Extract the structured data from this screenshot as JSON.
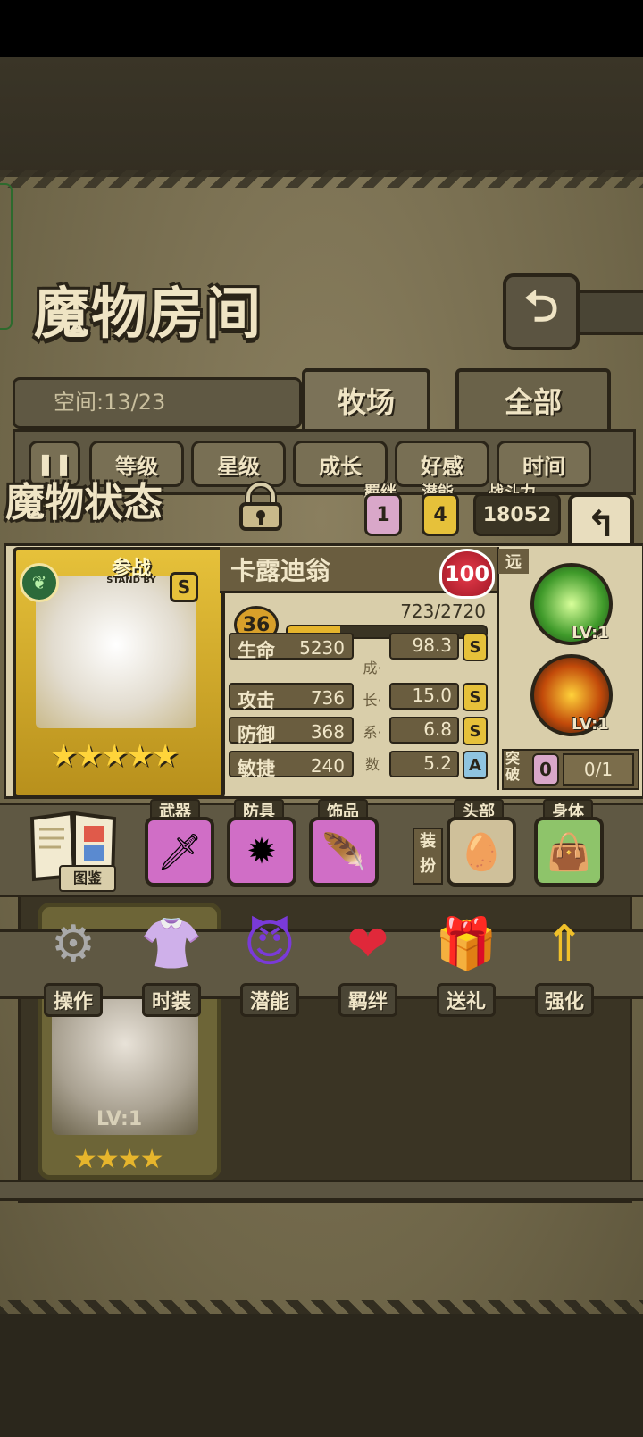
{
  "room": {
    "title": "魔物房间",
    "space_label": "空间:13/23",
    "tabs": [
      {
        "label": "牧场"
      },
      {
        "label": "全部"
      }
    ],
    "filters": [
      {
        "label": "等级"
      },
      {
        "label": "星级"
      },
      {
        "label": "成长"
      },
      {
        "label": "好感"
      },
      {
        "label": "时间"
      }
    ]
  },
  "popup": {
    "title": "魔物状态",
    "bond_label": "羁绊",
    "bond_value": "1",
    "potential_label": "潜能",
    "potential_value": "4",
    "power_label": "战斗力",
    "power_value": "18052",
    "standby": "参战",
    "standby_sub": "STAND BY",
    "rank": "S",
    "stars": "★★★★★",
    "monster_name": "卡露迪翁",
    "affection": "100",
    "level": "36",
    "exp_text": "723/2720",
    "exp_progress": 0.266,
    "growth_label": "成·长·系·数",
    "stats": [
      {
        "label": "生命",
        "value": "5230",
        "growth": "98.3",
        "rank": "S"
      },
      {
        "label": "攻击",
        "value": "736",
        "growth": "15.0",
        "rank": "S"
      },
      {
        "label": "防御",
        "value": "368",
        "growth": "6.8",
        "rank": "S"
      },
      {
        "label": "敏捷",
        "value": "240",
        "growth": "5.2",
        "rank": "A"
      }
    ],
    "range_tag": "远",
    "skills": [
      {
        "icon": "leaf-skill-icon",
        "level": "LV:1"
      },
      {
        "icon": "fire-sword-skill-icon",
        "level": "LV:1"
      }
    ],
    "breakthrough_label": "突破",
    "breakthrough_count": "0",
    "breakthrough_progress": "0/1"
  },
  "equipment": {
    "book_label": "图鉴",
    "slots": [
      {
        "label": "武器",
        "icon": "sword-icon"
      },
      {
        "label": "防具",
        "icon": "crystal-icon"
      },
      {
        "label": "饰品",
        "icon": "horn-icon"
      },
      {
        "label": "头部",
        "icon": "nest-egg-icon"
      },
      {
        "label": "身体",
        "icon": "bag-icon"
      }
    ],
    "outfit_tag": "装扮"
  },
  "actions": [
    {
      "label": "操作",
      "icon": "gear-icon"
    },
    {
      "label": "时装",
      "icon": "outfit-icon"
    },
    {
      "label": "潜能",
      "icon": "demon-icon"
    },
    {
      "label": "羁绊",
      "icon": "hearts-icon"
    },
    {
      "label": "送礼",
      "icon": "gift-icon"
    },
    {
      "label": "强化",
      "icon": "upgrade-arrows-icon"
    }
  ],
  "background_card": {
    "level": "LV:1",
    "stars": "★★★★"
  },
  "colors": {
    "accent_gold": "#e6c13a",
    "parchment": "#d9ceaa",
    "dark_outline": "#2a2418",
    "pink_badge": "#d9a7c9"
  }
}
